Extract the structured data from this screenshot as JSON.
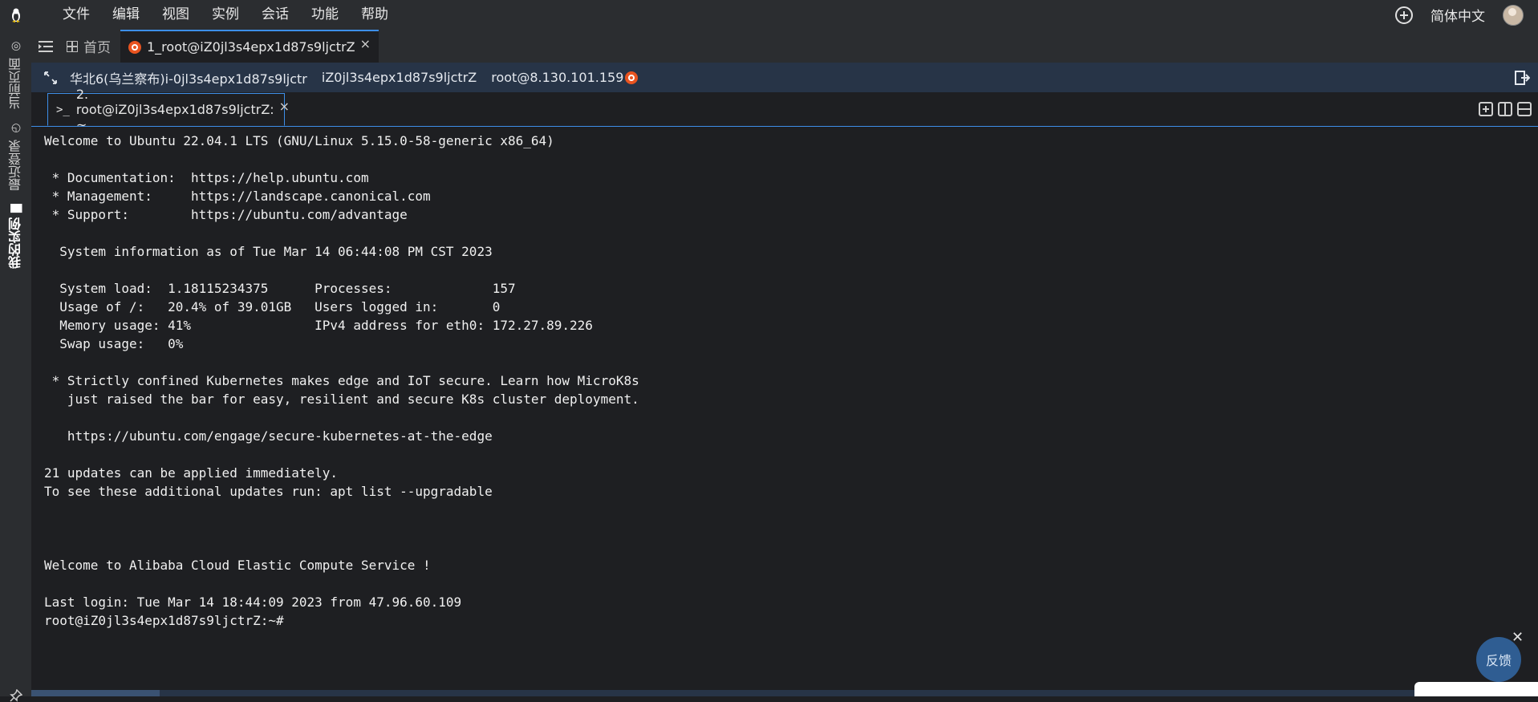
{
  "menubar": {
    "items": [
      "文件",
      "编辑",
      "视图",
      "实例",
      "会话",
      "功能",
      "帮助"
    ],
    "language": "简体中文"
  },
  "sidebar": {
    "items": [
      {
        "label": "当前页面",
        "icon": "page-icon"
      },
      {
        "label": "最近登录",
        "icon": "clock-icon"
      },
      {
        "label": "我的实例",
        "icon": "list-icon",
        "active": true
      }
    ]
  },
  "tabs": {
    "home_label": "首页",
    "session_label": "1_root@iZ0jl3s4epx1d87s9ljctrZ"
  },
  "infobar": {
    "region": "华北6(乌兰察布)i-0jl3s4epx1d87s9ljctr",
    "hostname": "iZ0jl3s4epx1d87s9ljctrZ",
    "login": "root@8.130.101.159"
  },
  "terminal_tab": {
    "label": "2. root@iZ0jl3s4epx1d87s9ljctrZ: ~"
  },
  "terminal": {
    "lines": [
      "Welcome to Ubuntu 22.04.1 LTS (GNU/Linux 5.15.0-58-generic x86_64)",
      "",
      " * Documentation:  https://help.ubuntu.com",
      " * Management:     https://landscape.canonical.com",
      " * Support:        https://ubuntu.com/advantage",
      "",
      "  System information as of Tue Mar 14 06:44:08 PM CST 2023",
      "",
      "  System load:  1.18115234375      Processes:             157",
      "  Usage of /:   20.4% of 39.01GB   Users logged in:       0",
      "  Memory usage: 41%                IPv4 address for eth0: 172.27.89.226",
      "  Swap usage:   0%",
      "",
      " * Strictly confined Kubernetes makes edge and IoT secure. Learn how MicroK8s",
      "   just raised the bar for easy, resilient and secure K8s cluster deployment.",
      "",
      "   https://ubuntu.com/engage/secure-kubernetes-at-the-edge",
      "",
      "21 updates can be applied immediately.",
      "To see these additional updates run: apt list --upgradable",
      "",
      "",
      "",
      "Welcome to Alibaba Cloud Elastic Compute Service !",
      "",
      "Last login: Tue Mar 14 18:44:09 2023 from 47.96.60.109",
      "root@iZ0jl3s4epx1d87s9ljctrZ:~#"
    ]
  },
  "feedback": {
    "label": "反馈"
  },
  "colors": {
    "accent": "#3d8ee8",
    "infobar_bg": "#273447",
    "ubuntu_orange": "#e95420",
    "feedback_bg": "#2f5d92"
  }
}
